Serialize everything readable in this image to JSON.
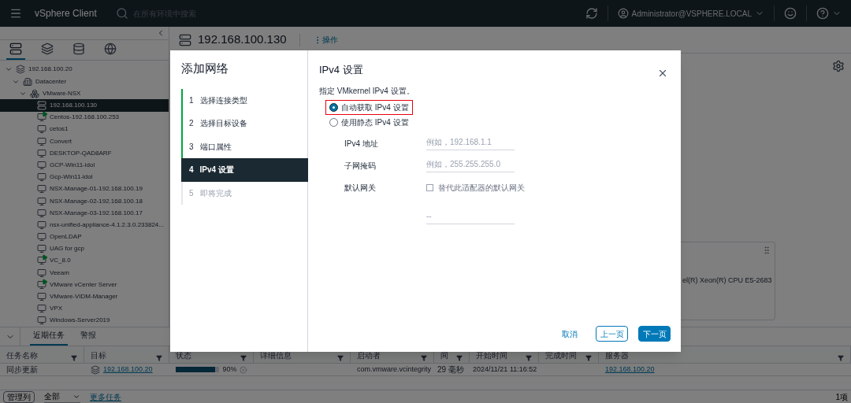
{
  "top_bar": {
    "app_title": "vSphere Client",
    "search": {
      "placeholder": "在所有环境中搜索"
    },
    "user": "Administrator@VSPHERE.LOCAL"
  },
  "sidebar": {
    "view_tabs": [
      {
        "selected": true
      },
      {
        "selected": false
      },
      {
        "selected": false
      },
      {
        "selected": false
      }
    ],
    "tree": [
      {
        "label": "192.168.100.20",
        "kind": "vcenter",
        "expanded": true,
        "children": [
          {
            "label": "Datacenter",
            "kind": "datacenter",
            "expanded": true,
            "children": [
              {
                "label": "VMware-NSX",
                "kind": "cluster",
                "expanded": true,
                "children": [
                  {
                    "label": "192.168.100.130",
                    "kind": "host",
                    "selected": true
                  },
                  {
                    "label": "Centos-192.168.100.253",
                    "kind": "vm",
                    "powered_on": true,
                    "selected": false
                  },
                  {
                    "label": "cetos1",
                    "kind": "vm",
                    "powered_on": false,
                    "selected": false
                  },
                  {
                    "label": "Convert",
                    "kind": "vm",
                    "powered_on": false,
                    "selected": false
                  },
                  {
                    "label": "DESKTOP-QAD8ARF",
                    "kind": "vm",
                    "powered_on": false,
                    "selected": false
                  },
                  {
                    "label": "GCP-Win11-idol",
                    "kind": "vm",
                    "powered_on": false,
                    "selected": false
                  },
                  {
                    "label": "Gcp-Win11-idol",
                    "kind": "vm",
                    "powered_on": false,
                    "selected": false
                  },
                  {
                    "label": "NSX-Manage-01-192.168.100.19",
                    "kind": "vm",
                    "powered_on": false,
                    "selected": false
                  },
                  {
                    "label": "NSX-Manage-02-192.168.100.18",
                    "kind": "vm",
                    "powered_on": false,
                    "selected": false
                  },
                  {
                    "label": "NSX-Manage-03-192.168.100.17",
                    "kind": "vm",
                    "powered_on": false,
                    "selected": false
                  },
                  {
                    "label": "nsx-unified-appliance-4.1.2.3.0.233824...",
                    "kind": "vm",
                    "powered_on": false,
                    "selected": false
                  },
                  {
                    "label": "OpenLDAP",
                    "kind": "vm",
                    "powered_on": false,
                    "selected": false
                  },
                  {
                    "label": "UAG for gcp",
                    "kind": "vm",
                    "powered_on": false,
                    "selected": false
                  },
                  {
                    "label": "VC_8.0",
                    "kind": "vm",
                    "powered_on": true,
                    "selected": false
                  },
                  {
                    "label": "Veeam",
                    "kind": "vm",
                    "powered_on": false,
                    "selected": false
                  },
                  {
                    "label": "VMware vCenter Server",
                    "kind": "vm",
                    "powered_on": true,
                    "selected": false
                  },
                  {
                    "label": "VMware-VIDM-Manager",
                    "kind": "vm",
                    "powered_on": false,
                    "selected": false
                  },
                  {
                    "label": "VPX",
                    "kind": "vm",
                    "powered_on": false,
                    "selected": false
                  },
                  {
                    "label": "Windows-Server2019",
                    "kind": "vm",
                    "powered_on": false,
                    "selected": false
                  }
                ]
              }
            ]
          }
        ]
      }
    ]
  },
  "object_header": {
    "title": "192.168.100.130",
    "actions": "操作"
  },
  "summary_card": {
    "cpu": "el(R) Xeon(R) CPU E5-2683"
  },
  "tasks_panel": {
    "tabs": [
      {
        "label": "近期任务",
        "selected": true
      },
      {
        "label": "警报",
        "selected": false
      }
    ],
    "columns": [
      "任务名称",
      "目标",
      "状态",
      "详细信息",
      "启动者",
      "间",
      "开始时间",
      "完成时间",
      "服务器"
    ],
    "rows": [
      {
        "task": "同步更新",
        "target": "192.168.100.20",
        "level": 0.9,
        "percent": "90%",
        "initiator": "com.vmware.vcintegrity",
        "queued": "29 毫秒",
        "start": "2024/11/21 11:16:52",
        "server": "192.168.100.20"
      }
    ],
    "footer": {
      "manage_columns": "管理列",
      "filter": "全部",
      "more_tasks": "更多任务",
      "count": "1项"
    }
  },
  "dialog": {
    "title": "添加网络",
    "steps": [
      {
        "number": "1",
        "label": "选择连接类型",
        "completed": true,
        "selected": false
      },
      {
        "number": "2",
        "label": "选择目标设备",
        "completed": true,
        "selected": false
      },
      {
        "number": "3",
        "label": "端口属性",
        "completed": true,
        "selected": false
      },
      {
        "number": "4",
        "label": "IPv4 设置",
        "completed": false,
        "selected": true
      },
      {
        "number": "5",
        "label": "即将完成",
        "completed": false,
        "selected": false
      }
    ],
    "page_title": "IPv4 设置",
    "instruction": "指定 VMkernel IPv4 设置。",
    "options": [
      {
        "label": "自动获取 IPv4 设置",
        "selected": true,
        "highlighted": true
      },
      {
        "label": "使用静态 IPv4 设置",
        "selected": false,
        "highlighted": false
      }
    ],
    "fields": [
      {
        "label": "IPv4 地址",
        "placeholder": "例如，192.168.1.1"
      },
      {
        "label": "子网掩码",
        "placeholder": "例如，255.255.255.0"
      }
    ],
    "gateway": {
      "label": "默认网关",
      "override": {
        "label": "替代此适配器的默认网关",
        "checked": false
      },
      "placeholder": "--"
    },
    "buttons": [
      {
        "label": "取消",
        "kind": "link"
      },
      {
        "label": "上一页",
        "kind": "secondary"
      },
      {
        "label": "下一页",
        "kind": "primary"
      }
    ]
  }
}
